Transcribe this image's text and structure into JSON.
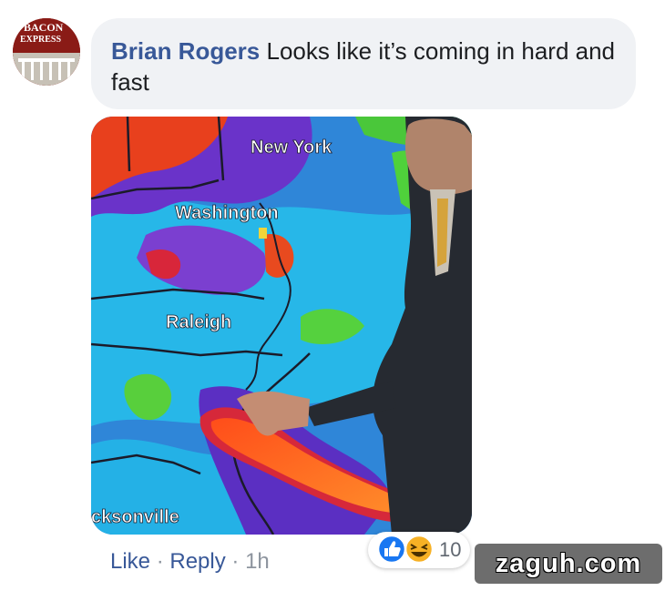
{
  "comment": {
    "author": "Brian Rogers",
    "text": "Looks like it’s coming in hard and fast",
    "avatar_text": [
      "BACON",
      "EXPRESS"
    ]
  },
  "photo": {
    "labels": {
      "new_york": "New York",
      "washington": "Washington",
      "raleigh": "Raleigh",
      "jacksonville": "cksonville"
    }
  },
  "actions": {
    "like": "Like",
    "separator1": "·",
    "reply": "Reply",
    "separator2": "·",
    "time": "1h"
  },
  "reactions": {
    "count": "10",
    "icons": [
      "like-icon",
      "haha-icon"
    ],
    "colors": {
      "like": "#1877f2",
      "haha": "#f7b125"
    }
  },
  "watermark": {
    "text": "zaguh.com"
  },
  "colors": {
    "author_link": "#385898",
    "bubble_bg": "#f0f2f5",
    "meta_gray": "#8d949e"
  }
}
